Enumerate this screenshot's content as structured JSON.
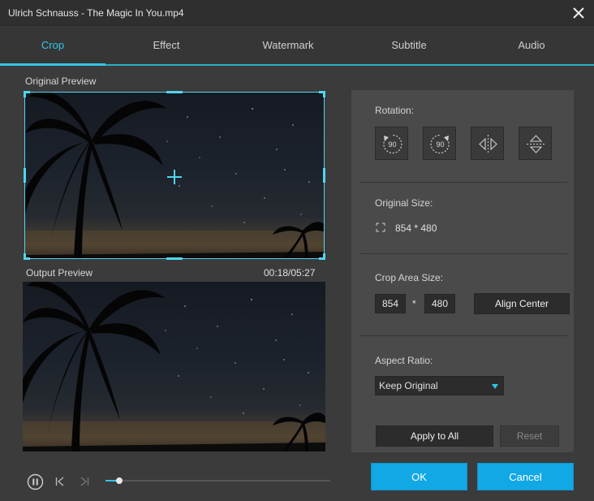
{
  "window": {
    "title": "Ulrich Schnauss - The Magic In You.mp4"
  },
  "tabs": [
    {
      "label": "Crop",
      "active": true
    },
    {
      "label": "Effect",
      "active": false
    },
    {
      "label": "Watermark",
      "active": false
    },
    {
      "label": "Subtitle",
      "active": false
    },
    {
      "label": "Audio",
      "active": false
    }
  ],
  "preview": {
    "original_label": "Original Preview",
    "output_label": "Output Preview",
    "time": "00:18/05:27"
  },
  "panel": {
    "rotation_label": "Rotation:",
    "rotation_buttons": [
      {
        "icon": "rotate-left-90-icon",
        "text": "90"
      },
      {
        "icon": "rotate-right-90-icon",
        "text": "90"
      },
      {
        "icon": "flip-horizontal-icon"
      },
      {
        "icon": "flip-vertical-icon"
      }
    ],
    "original_size_label": "Original Size:",
    "original_size_value": "854 * 480",
    "crop_area_label": "Crop Area Size:",
    "crop_width": "854",
    "crop_separator": "*",
    "crop_height": "480",
    "align_center_label": "Align Center",
    "aspect_ratio_label": "Aspect Ratio:",
    "aspect_ratio_value": "Keep Original",
    "apply_all_label": "Apply to All",
    "reset_label": "Reset"
  },
  "footer": {
    "ok_label": "OK",
    "cancel_label": "Cancel",
    "progress": 0.06
  },
  "colors": {
    "accent": "#33c6e8",
    "primary_button": "#12a8e6",
    "background": "#3b3b3b",
    "panel": "#4a4a4a"
  }
}
